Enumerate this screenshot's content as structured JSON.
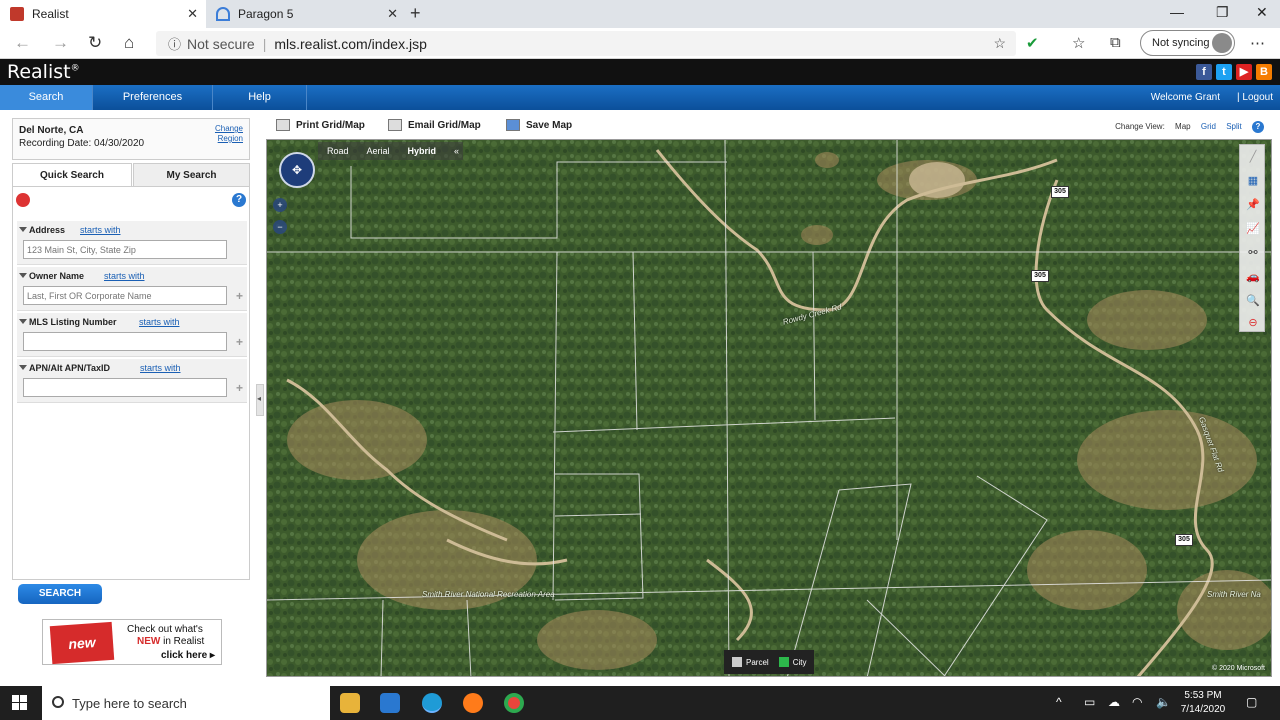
{
  "browser": {
    "tabs": [
      {
        "label": "Realist",
        "active": true
      },
      {
        "label": "Paragon 5",
        "active": false
      }
    ],
    "address": {
      "security": "Not secure",
      "url": "mls.realist.com/index.jsp"
    },
    "sync_label": "Not syncing"
  },
  "app": {
    "logo": "Realist",
    "logo_mark": "®",
    "nav": [
      "Search",
      "Preferences",
      "Help"
    ],
    "welcome": "Welcome Grant",
    "logout": "Logout"
  },
  "location": {
    "city": "Del Norte, CA",
    "recording_date": "Recording Date: 04/30/2020",
    "change_line1": "Change",
    "change_line2": "Region"
  },
  "search_tabs": [
    "Quick Search",
    "My Search"
  ],
  "fields": [
    {
      "label": "Address",
      "mode": "starts with",
      "placeholder": "123 Main St, City, State Zip"
    },
    {
      "label": "Owner Name",
      "mode": "starts with",
      "placeholder": "Last, First OR Corporate Name"
    },
    {
      "label": "MLS Listing Number",
      "mode": "starts with",
      "placeholder": ""
    },
    {
      "label": "APN/Alt APN/TaxID",
      "mode": "starts with",
      "placeholder": ""
    }
  ],
  "search_button": "SEARCH",
  "promo": {
    "badge": "new",
    "line1": "Check out what's",
    "line2_red": "NEW",
    "line2_rest": " in Realist",
    "line3": "click here ▸"
  },
  "map_toolbar": {
    "print": "Print Grid/Map",
    "email": "Email Grid/Map",
    "save": "Save Map",
    "change_view": "Change View:",
    "views": [
      "Map",
      "Grid",
      "Split"
    ]
  },
  "map": {
    "types": [
      "Road",
      "Aerial",
      "Hybrid"
    ],
    "legend": [
      "Parcel",
      "City"
    ],
    "labels": [
      {
        "text": "Smith River National Recreation Area"
      },
      {
        "text": "Smith River Na"
      },
      {
        "text": "Rowdy Creek Rd"
      },
      {
        "text": "Gasquet Flat Rd"
      }
    ],
    "shields": [
      "305",
      "305",
      "305"
    ],
    "copyright": "© 2020 Microsoft"
  },
  "taskbar": {
    "search_placeholder": "Type here to search",
    "time": "5:53 PM",
    "date": "7/14/2020"
  },
  "colors": {
    "nav_blue": "#0b4f9a",
    "accent": "#1a5fb4",
    "forest": "#3c5a2b"
  }
}
